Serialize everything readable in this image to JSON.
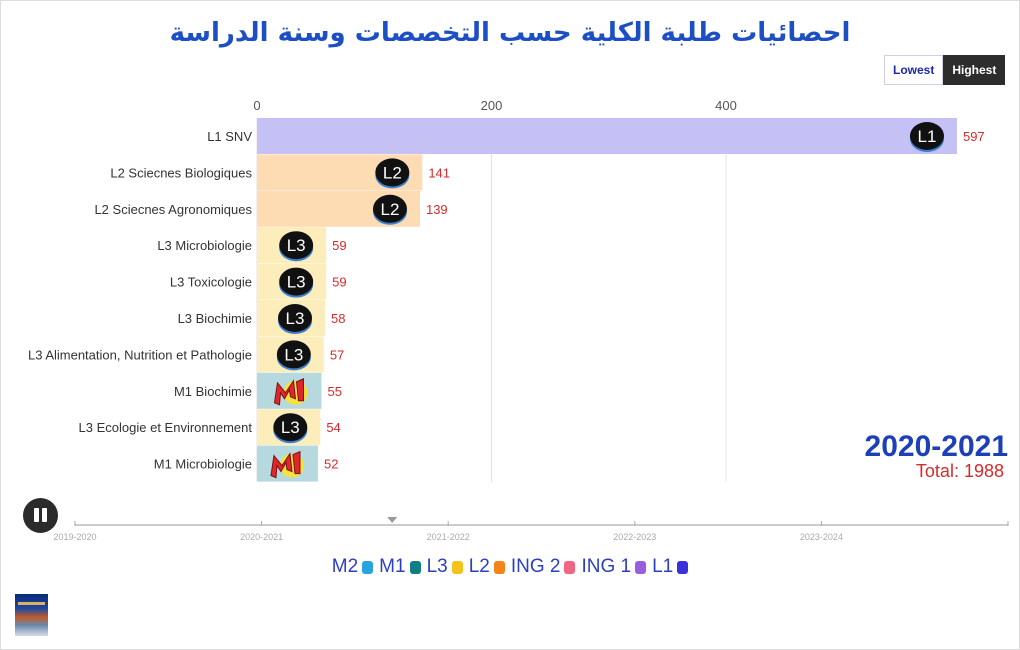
{
  "title": "احصائيات طلبة الكلية حسب التخصصات وسنة الدراسة",
  "sort_buttons": {
    "lowest": "Lowest",
    "highest": "Highest",
    "active": "highest"
  },
  "current_year": "2020-2021",
  "total_text": "Total: 1988",
  "play_state": "playing",
  "timeline": {
    "ticks": [
      "2019-2020",
      "2020-2021",
      "2021-2022",
      "2022-2023",
      "2023-2024"
    ],
    "progress_fraction": 0.34
  },
  "legend": [
    {
      "label": "M2",
      "color": "#29a3e0"
    },
    {
      "label": "M1",
      "color": "#0e7f82"
    },
    {
      "label": "L3",
      "color": "#f5c21b"
    },
    {
      "label": "L2",
      "color": "#f4841a"
    },
    {
      "label": "ING 2",
      "color": "#f06682"
    },
    {
      "label": "ING 1",
      "color": "#9a5ddb"
    },
    {
      "label": "L1",
      "color": "#3a2fd8"
    }
  ],
  "chart_data": {
    "type": "bar",
    "orientation": "horizontal",
    "title": "احصائيات طلبة الكلية حسب التخصصات وسنة الدراسة",
    "xlabel": "",
    "ylabel": "",
    "xlim": [
      0,
      600
    ],
    "x_ticks": [
      0,
      200,
      400
    ],
    "grid": true,
    "categories": [
      "L1 SNV",
      "L2 Sciecnes Biologiques",
      "L2 Sciecnes Agronomiques",
      "L3 Microbiologie",
      "L3 Toxicologie",
      "L3 Biochimie",
      "L3 Alimentation, Nutrition et Pathologie",
      "M1 Biochimie",
      "L3 Ecologie et Environnement",
      "M1 Microbiologie"
    ],
    "values": [
      597,
      141,
      139,
      59,
      59,
      58,
      57,
      55,
      54,
      52
    ],
    "groups": [
      "L1",
      "L2",
      "L2",
      "L3",
      "L3",
      "L3",
      "L3",
      "M1",
      "L3",
      "M1"
    ],
    "bar_colors": {
      "L1": "#c5c1f5",
      "L2": "#fddbb3",
      "L3": "#fdedbb",
      "M1": "#b5d9df"
    },
    "badges": [
      "L1",
      "L2",
      "L2",
      "L3",
      "L3",
      "L3",
      "L3",
      "M1",
      "L3",
      "M1"
    ],
    "value_label_color": "#d52b2b"
  }
}
